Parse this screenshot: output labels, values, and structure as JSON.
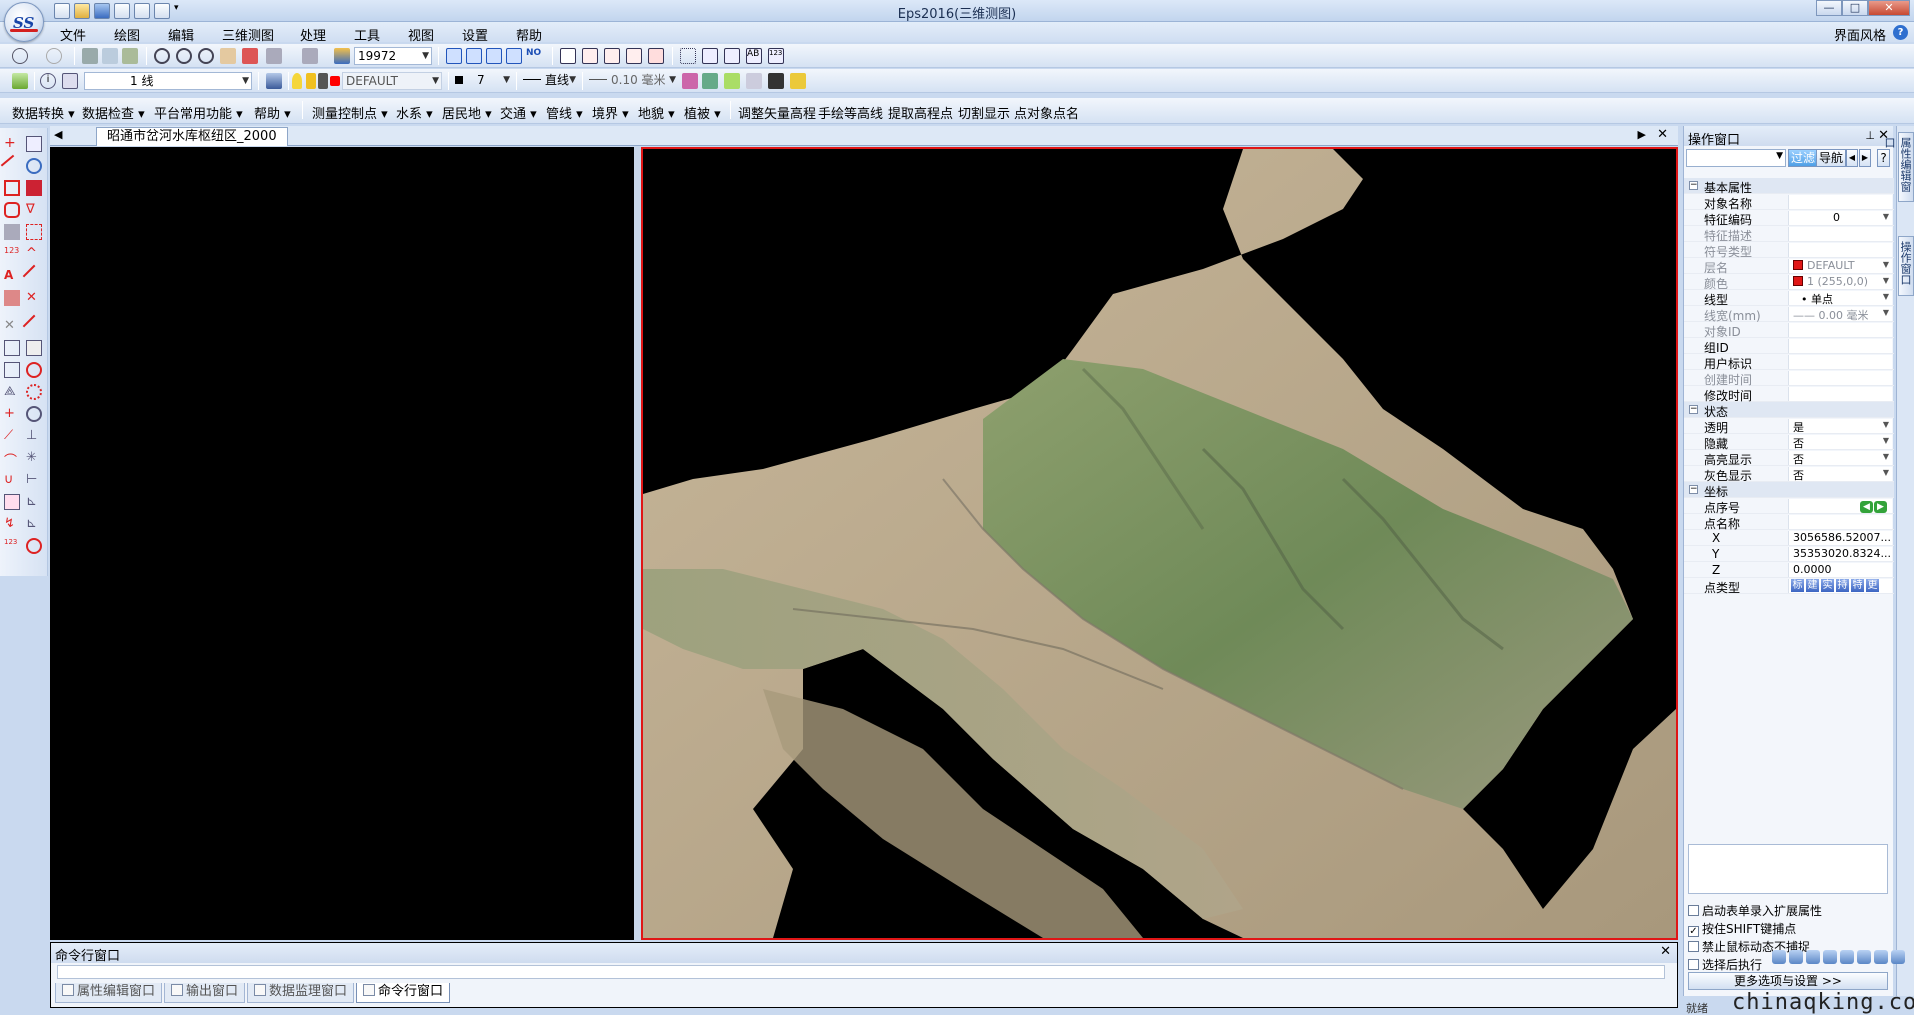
{
  "window": {
    "title": "Eps2016(三维测图)",
    "controls": [
      "—",
      "□",
      "✕"
    ]
  },
  "menu": {
    "items": [
      "文件",
      "绘图",
      "编辑",
      "三维测图",
      "处理",
      "工具",
      "视图",
      "设置",
      "帮助"
    ],
    "ui_style_label": "界面风格",
    "help_icon": "?"
  },
  "toolbar1": {
    "zoom_value": "19972"
  },
  "toolbar2": {
    "line_style_combo": "1 线",
    "layer_combo": "DEFAULT",
    "color_combo": "7",
    "linetype_combo": "直线",
    "linewidth_combo": "0.10 毫米"
  },
  "toolbar3": {
    "items": [
      "数据转换",
      "数据检查",
      "平台常用功能",
      "帮助",
      "测量控制点",
      "水系",
      "居民地",
      "交通",
      "管线",
      "境界",
      "地貌",
      "植被"
    ],
    "plain_items": [
      "调整矢量高程",
      "手绘等高线",
      "提取高程点",
      "切割显示",
      "点对象点名"
    ]
  },
  "document": {
    "tab_title": "昭通市岔河水库枢纽区_2000"
  },
  "ops_panel": {
    "title": "操作窗口",
    "filter_btn": "过滤",
    "nav_btn": "导航",
    "help_btn": "?",
    "categories": {
      "basic": "基本属性",
      "state": "状态",
      "coord": "坐标"
    },
    "basic_rows": [
      {
        "name": "对象名称",
        "value": ""
      },
      {
        "name": "特征编码",
        "value": "0"
      },
      {
        "name": "特征描述",
        "value": ""
      },
      {
        "name": "符号类型",
        "value": ""
      },
      {
        "name": "层名",
        "value": "DEFAULT"
      },
      {
        "name": "颜色",
        "value": "1 (255,0,0)"
      },
      {
        "name": "线型",
        "value": "• 单点"
      },
      {
        "name": "线宽(mm)",
        "value": "—— 0.00 毫米"
      },
      {
        "name": "对象ID",
        "value": ""
      },
      {
        "name": "组ID",
        "value": ""
      },
      {
        "name": "用户标识",
        "value": ""
      },
      {
        "name": "创建时间",
        "value": ""
      },
      {
        "name": "修改时间",
        "value": ""
      }
    ],
    "state_rows": [
      {
        "name": "透明",
        "value": "是"
      },
      {
        "name": "隐藏",
        "value": "否"
      },
      {
        "name": "高亮显示",
        "value": "否"
      },
      {
        "name": "灰色显示",
        "value": "否"
      }
    ],
    "coord_rows": [
      {
        "name": "点序号",
        "value": ""
      },
      {
        "name": "点名称",
        "value": ""
      },
      {
        "name": "X",
        "value": "3056586.52007..."
      },
      {
        "name": "Y",
        "value": "35353020.8324..."
      },
      {
        "name": "Z",
        "value": "0.0000"
      }
    ],
    "point_type_label": "点类型",
    "point_type_btns": [
      "标",
      "建",
      "实",
      "持",
      "特",
      "更"
    ],
    "checkboxes": [
      {
        "label": "启动表单录入扩展属性",
        "checked": false
      },
      {
        "label": "按住SHIFT键捕点",
        "checked": true
      },
      {
        "label": "禁止鼠标动态不捕捉",
        "checked": false
      },
      {
        "label": "选择后执行",
        "checked": false
      }
    ],
    "more_options": "更多选项与设置 >>"
  },
  "side_tabs": [
    "属性编辑窗口",
    "操作窗口"
  ],
  "command_window": {
    "title": "命令行窗口",
    "tabs": [
      "属性编辑窗口",
      "输出窗口",
      "数据监理窗口",
      "命令行窗口"
    ]
  },
  "status": {
    "left_text": "就绪",
    "watermark": "chinaqking.com"
  },
  "colors": {
    "viewport_border": "#e01616",
    "layer_color": "#ff0000"
  }
}
